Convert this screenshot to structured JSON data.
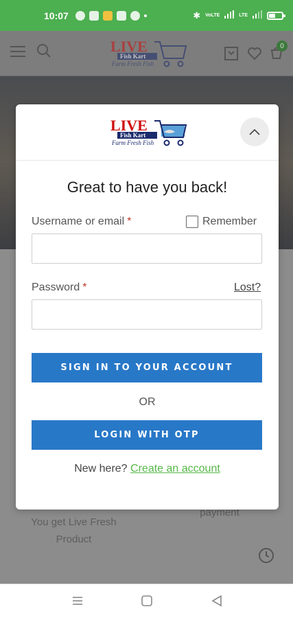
{
  "status_bar": {
    "time": "10:07",
    "signal_label_1": "VoLTE",
    "signal_label_2": "LTE"
  },
  "header": {
    "cart_count": "0"
  },
  "logo": {
    "line1": "LIVE",
    "line2": "Fish Kart",
    "tagline": "Farm Fresh Fish"
  },
  "background": {
    "left_text": "You get Live Fresh Product",
    "right_text": "payment"
  },
  "modal": {
    "title": "Great to have you back!",
    "username_label": "Username or email",
    "required_mark": "*",
    "remember_label": "Remember",
    "password_label": "Password",
    "lost_link": "Lost?",
    "username_value": "",
    "password_value": "",
    "signin_button": "SIGN IN TO YOUR ACCOUNT",
    "or_text": "OR",
    "otp_button": "LOGIN WITH OTP",
    "new_here": "New here?",
    "create_account": "Create an account"
  },
  "colors": {
    "status_bar": "#4caf50",
    "primary_button": "#2878c8",
    "link_green": "#55b848",
    "required_red": "#c0392b"
  },
  "icons": {
    "header": [
      "menu-icon",
      "search-icon",
      "compare-icon",
      "heart-icon",
      "cart-icon"
    ],
    "modal": [
      "chevron-up-icon"
    ],
    "nav": [
      "recent-apps-icon",
      "home-icon",
      "back-icon"
    ],
    "fab": [
      "clock-icon"
    ]
  }
}
